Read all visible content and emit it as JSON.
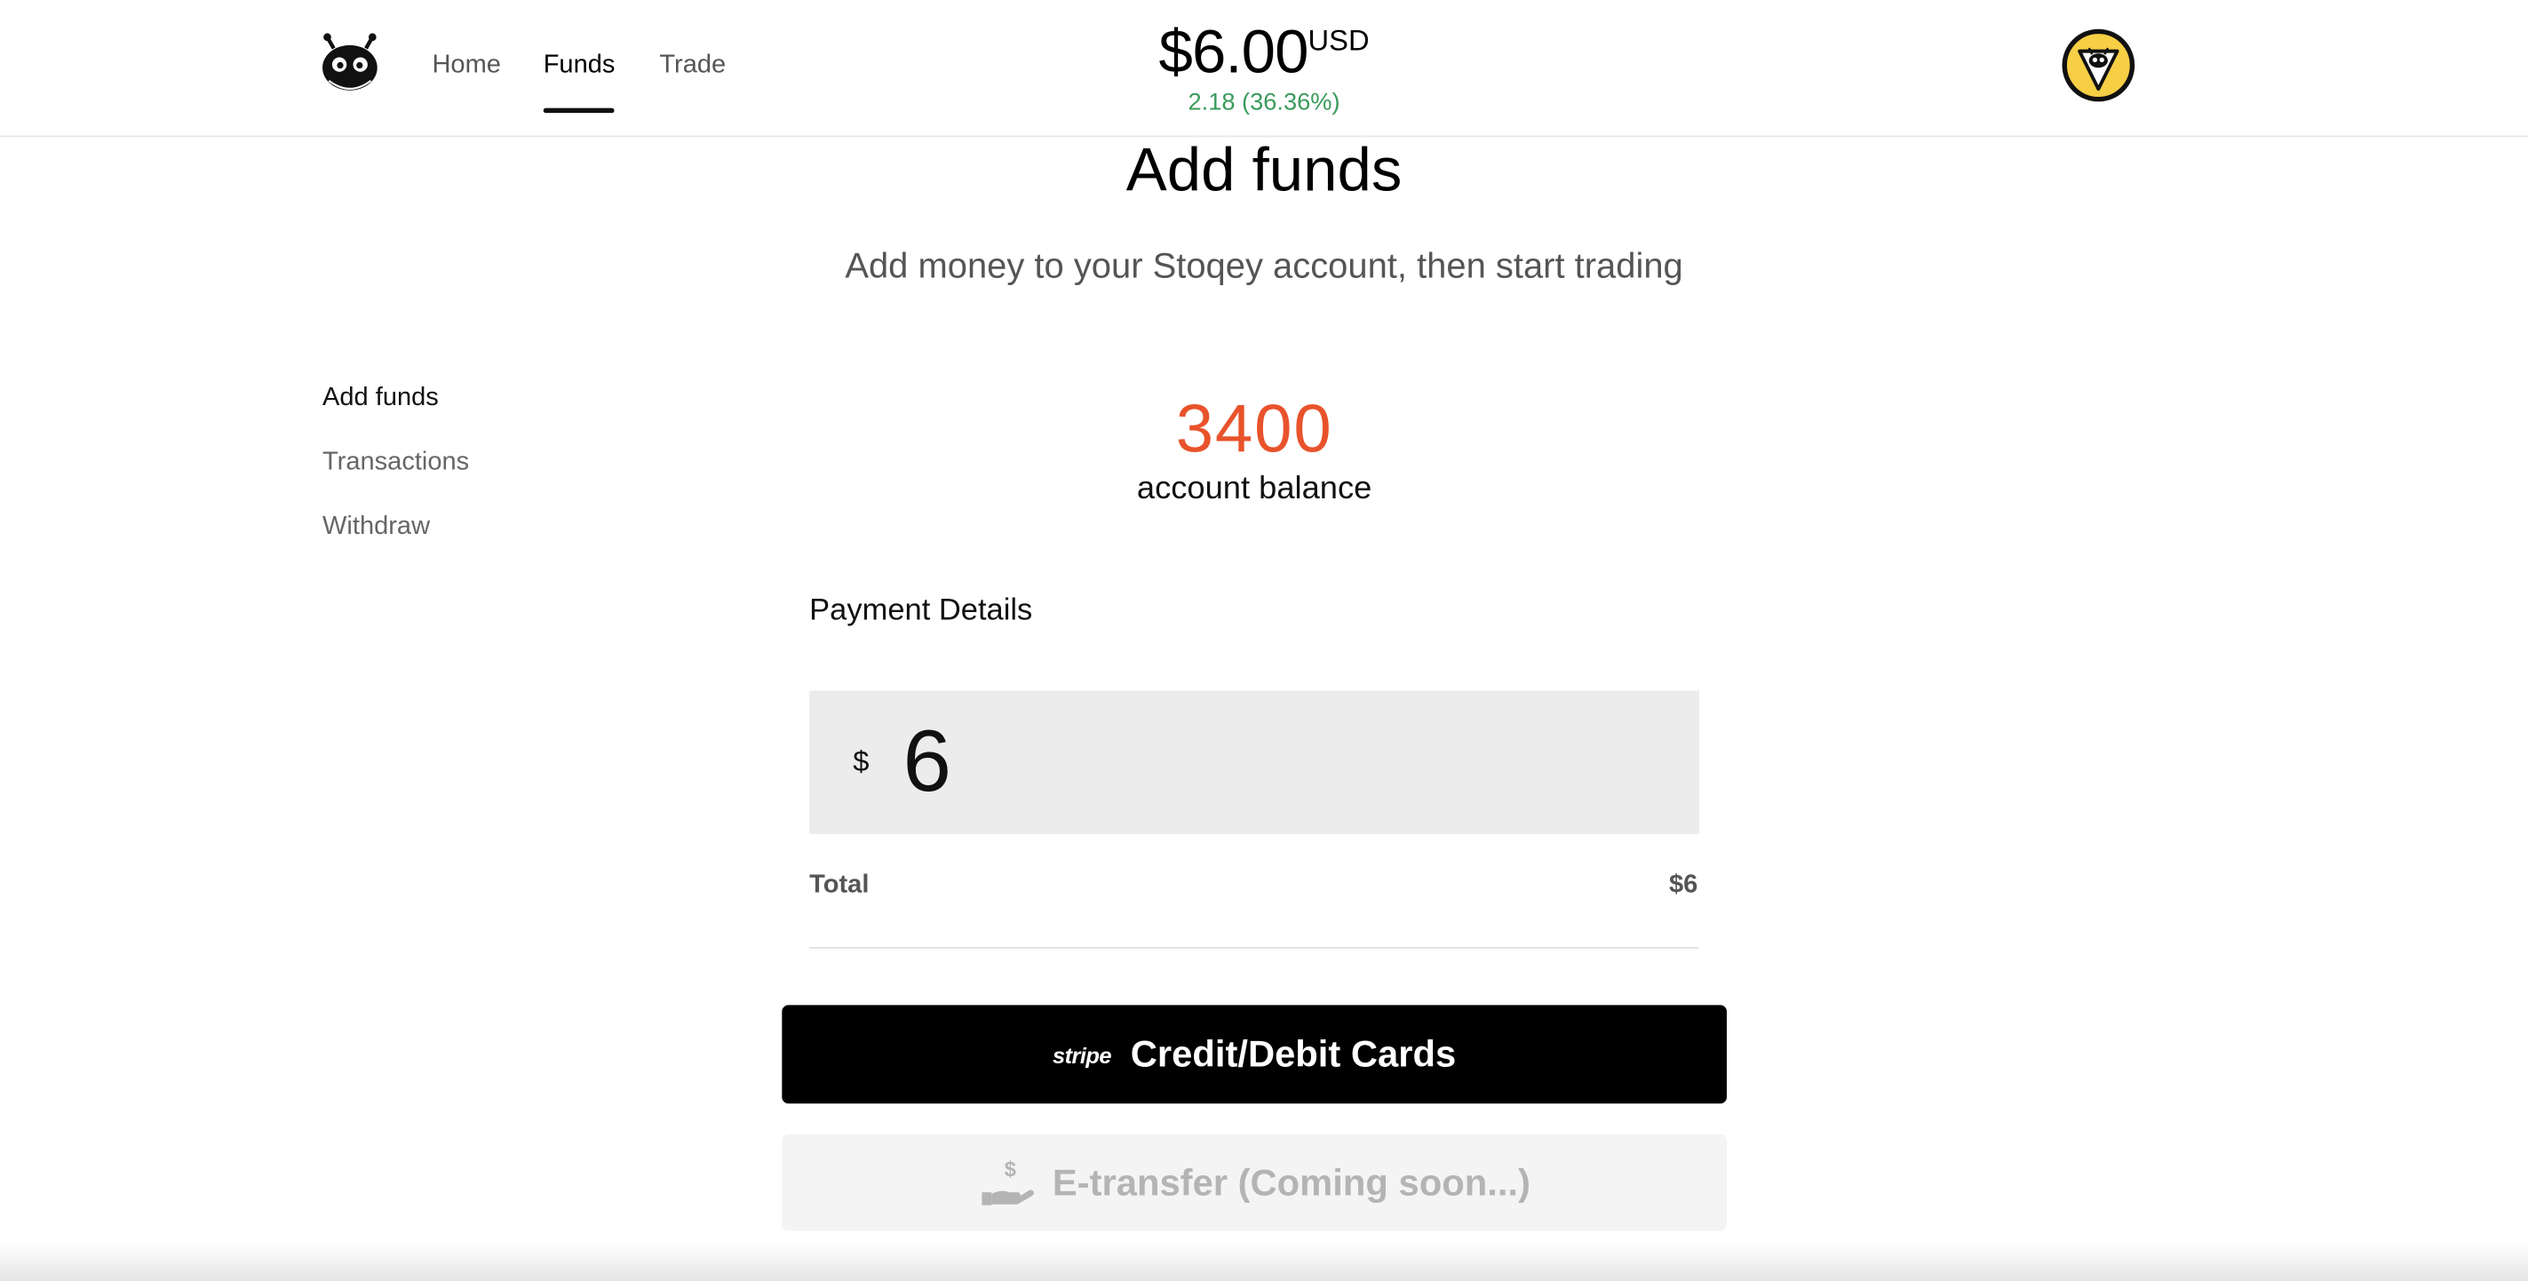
{
  "header": {
    "nav": [
      {
        "label": "Home"
      },
      {
        "label": "Funds"
      },
      {
        "label": "Trade"
      }
    ],
    "balance": "$6.00",
    "balance_unit": "USD",
    "balance_change": "2.18 (36.36%)",
    "logo_icon": "robot-logo-icon",
    "avatar_icon": "robot-avatar-icon",
    "accent_positive": "#3a9a5b"
  },
  "page": {
    "title": "Add funds",
    "subtitle": "Add money to your Stoqey account, then start trading"
  },
  "sidebar": {
    "items": [
      {
        "label": "Add funds"
      },
      {
        "label": "Transactions"
      },
      {
        "label": "Withdraw"
      }
    ]
  },
  "account": {
    "balance": "3400",
    "label": "account balance",
    "balance_color": "#e8532b"
  },
  "payment": {
    "title": "Payment Details",
    "currency_symbol": "$",
    "amount_value": "6",
    "total_label": "Total",
    "total_value": "$6"
  },
  "buttons": {
    "card_brand": "stripe",
    "card_label": "Credit/Debit Cards",
    "etransfer_label": "E-transfer (Coming soon...)",
    "etransfer_icon": "hand-dollar-icon"
  }
}
